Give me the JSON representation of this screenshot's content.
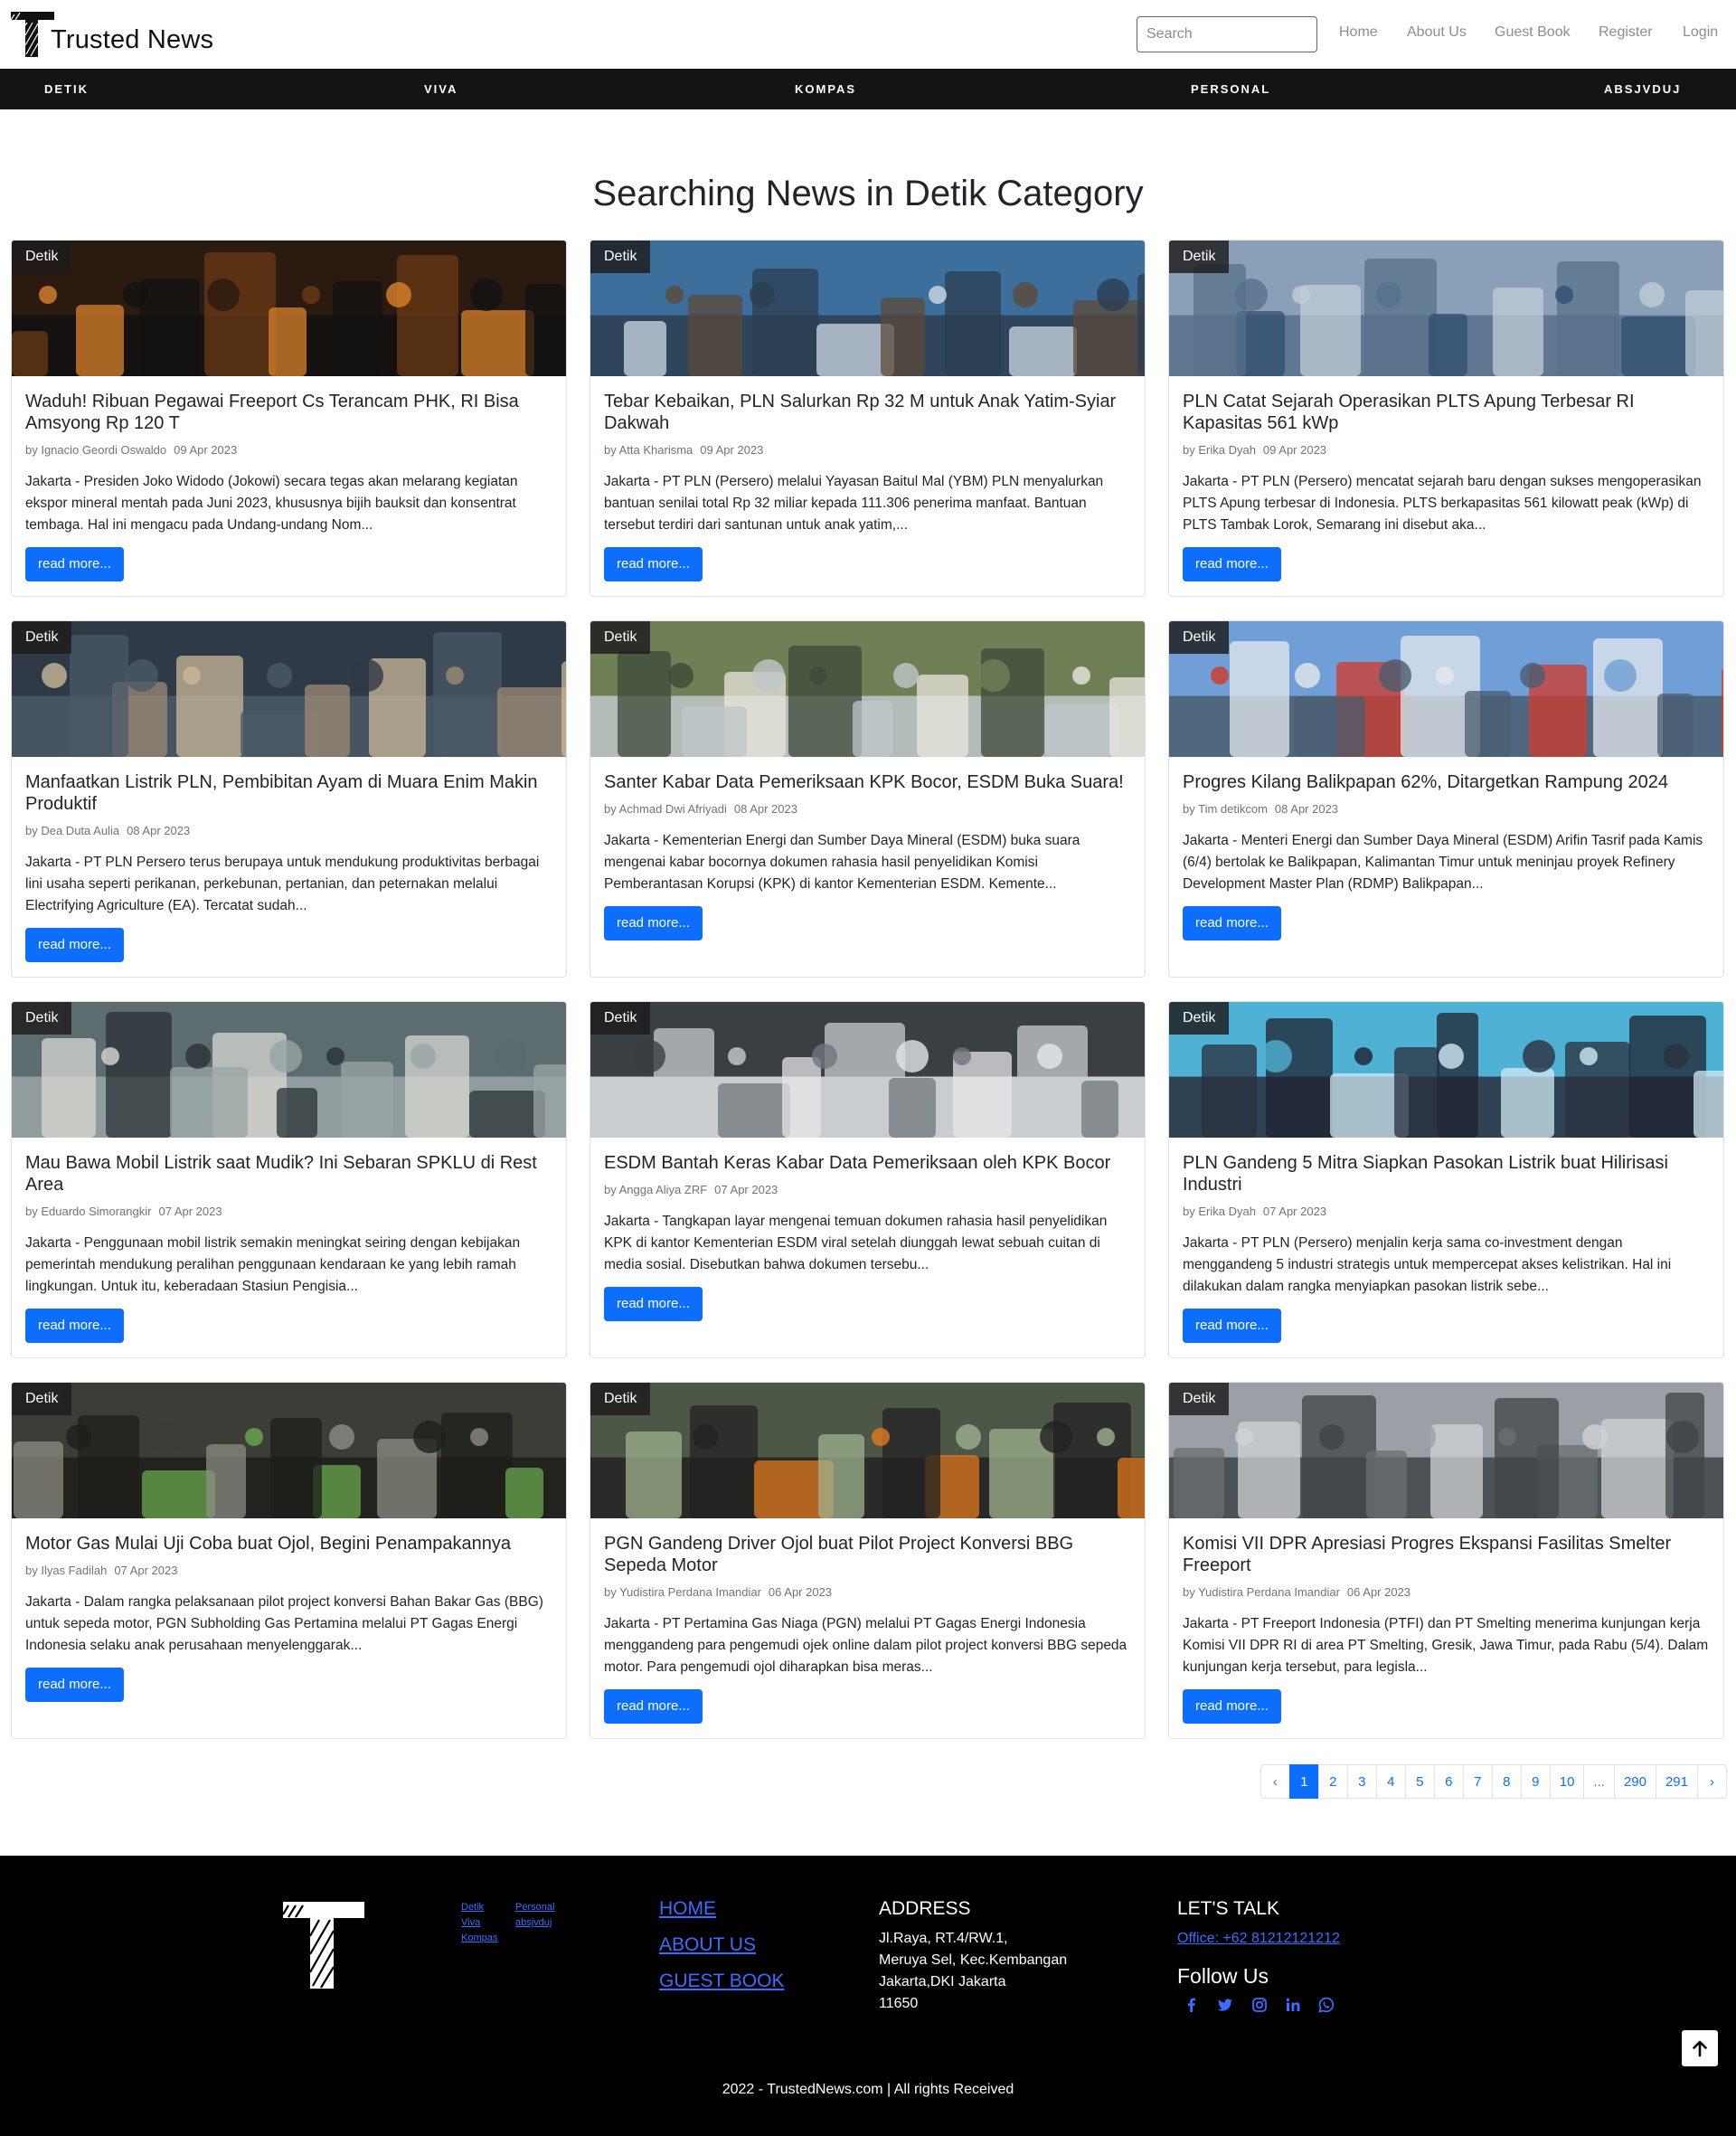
{
  "site": {
    "name": "Trusted News"
  },
  "search": {
    "placeholder": "Search"
  },
  "top_nav": [
    "Home",
    "About Us",
    "Guest Book",
    "Register",
    "Login"
  ],
  "categories": [
    "DETIK",
    "VIVA",
    "KOMPAS",
    "PERSONAL",
    "ABSJVDUJ"
  ],
  "page_title": "Searching News in Detik Category",
  "read_more_label": "read more...",
  "articles": [
    {
      "badge": "Detik",
      "title": "Waduh! Ribuan Pegawai Freeport Cs Terancam PHK, RI Bisa Amsyong Rp 120 T",
      "author": "by Ignacio Geordi Oswaldo",
      "date": "09 Apr 2023",
      "excerpt": "Jakarta - Presiden Joko Widodo (Jokowi) secara tegas akan melarang kegiatan ekspor mineral mentah pada Juni 2023, khususnya bijih bauksit dan konsentrat tembaga. Hal ini mengacu pada Undang-undang Nom..."
    },
    {
      "badge": "Detik",
      "title": "Tebar Kebaikan, PLN Salurkan Rp 32 M untuk Anak Yatim-Syiar Dakwah",
      "author": "by Atta Kharisma",
      "date": "09 Apr 2023",
      "excerpt": "Jakarta - PT PLN (Persero) melalui Yayasan Baitul Mal (YBM) PLN menyalurkan bantuan senilai total Rp 32 miliar kepada 111.306 penerima manfaat. Bantuan tersebut terdiri dari santunan untuk anak yatim,..."
    },
    {
      "badge": "Detik",
      "title": "PLN Catat Sejarah Operasikan PLTS Apung Terbesar RI Kapasitas 561 kWp",
      "author": "by Erika Dyah",
      "date": "09 Apr 2023",
      "excerpt": "Jakarta - PT PLN (Persero) mencatat sejarah baru dengan sukses mengoperasikan PLTS Apung terbesar di Indonesia. PLTS berkapasitas 561 kilowatt peak (kWp) di PLTS Tambak Lorok, Semarang ini disebut aka..."
    },
    {
      "badge": "Detik",
      "title": "Manfaatkan Listrik PLN, Pembibitan Ayam di Muara Enim Makin Produktif",
      "author": "by Dea Duta Aulia",
      "date": "08 Apr 2023",
      "excerpt": "Jakarta - PT PLN Persero terus berupaya untuk mendukung produktivitas berbagai lini usaha seperti perikanan, perkebunan, pertanian, dan peternakan melalui Electrifying Agriculture (EA). Tercatat sudah..."
    },
    {
      "badge": "Detik",
      "title": "Santer Kabar Data Pemeriksaan KPK Bocor, ESDM Buka Suara!",
      "author": "by Achmad Dwi Afriyadi",
      "date": "08 Apr 2023",
      "excerpt": "Jakarta - Kementerian Energi dan Sumber Daya Mineral (ESDM) buka suara mengenai kabar bocornya dokumen rahasia hasil penyelidikan Komisi Pemberantasan Korupsi (KPK) di kantor Kementerian ESDM. Kemente..."
    },
    {
      "badge": "Detik",
      "title": "Progres Kilang Balikpapan 62%, Ditargetkan Rampung 2024",
      "author": "by Tim detikcom",
      "date": "08 Apr 2023",
      "excerpt": "Jakarta - Menteri Energi dan Sumber Daya Mineral (ESDM) Arifin Tasrif pada Kamis (6/4) bertolak ke Balikpapan, Kalimantan Timur untuk meninjau proyek Refinery Development Master Plan (RDMP) Balikpapan..."
    },
    {
      "badge": "Detik",
      "title": "Mau Bawa Mobil Listrik saat Mudik? Ini Sebaran SPKLU di Rest Area",
      "author": "by Eduardo Simorangkir",
      "date": "07 Apr 2023",
      "excerpt": "Jakarta - Penggunaan mobil listrik semakin meningkat seiring dengan kebijakan pemerintah mendukung peralihan penggunaan kendaraan ke yang lebih ramah lingkungan. Untuk itu, keberadaan Stasiun Pengisia..."
    },
    {
      "badge": "Detik",
      "title": "ESDM Bantah Keras Kabar Data Pemeriksaan oleh KPK Bocor",
      "author": "by Angga Aliya ZRF",
      "date": "07 Apr 2023",
      "excerpt": "Jakarta - Tangkapan layar mengenai temuan dokumen rahasia hasil penyelidikan KPK di kantor Kementerian ESDM viral setelah diunggah lewat sebuah cuitan di media sosial. Disebutkan bahwa dokumen tersebu..."
    },
    {
      "badge": "Detik",
      "title": "PLN Gandeng 5 Mitra Siapkan Pasokan Listrik buat Hilirisasi Industri",
      "author": "by Erika Dyah",
      "date": "07 Apr 2023",
      "excerpt": "Jakarta - PT PLN (Persero) menjalin kerja sama co-investment dengan menggandeng 5 industri strategis untuk mempercepat akses kelistrikan. Hal ini dilakukan dalam rangka menyiapkan pasokan listrik sebe..."
    },
    {
      "badge": "Detik",
      "title": "Motor Gas Mulai Uji Coba buat Ojol, Begini Penampakannya",
      "author": "by Ilyas Fadilah",
      "date": "07 Apr 2023",
      "excerpt": "Jakarta - Dalam rangka pelaksanaan pilot project konversi Bahan Bakar Gas (BBG) untuk sepeda motor, PGN Subholding Gas Pertamina melalui PT Gagas Energi Indonesia selaku anak perusahaan menyelenggarak..."
    },
    {
      "badge": "Detik",
      "title": "PGN Gandeng Driver Ojol buat Pilot Project Konversi BBG Sepeda Motor",
      "author": "by Yudistira Perdana Imandiar",
      "date": "06 Apr 2023",
      "excerpt": "Jakarta - PT Pertamina Gas Niaga (PGN) melalui PT Gagas Energi Indonesia menggandeng para pengemudi ojek online dalam pilot project konversi BBG sepeda motor. Para pengemudi ojol diharapkan bisa meras..."
    },
    {
      "badge": "Detik",
      "title": "Komisi VII DPR Apresiasi Progres Ekspansi Fasilitas Smelter Freeport",
      "author": "by Yudistira Perdana Imandiar",
      "date": "06 Apr 2023",
      "excerpt": "Jakarta - PT Freeport Indonesia (PTFI) dan PT Smelting menerima kunjungan kerja Komisi VII DPR RI di area PT Smelting, Gresik, Jawa Timur, pada Rabu (5/4). Dalam kunjungan kerja tersebut, para legisla..."
    }
  ],
  "pagination": [
    "‹",
    "1",
    "2",
    "3",
    "4",
    "5",
    "6",
    "7",
    "8",
    "9",
    "10",
    "...",
    "290",
    "291",
    "›"
  ],
  "pagination_active": "1",
  "footer": {
    "categories": [
      "Detik",
      "Viva",
      "Kompas",
      "Personal",
      "absjvduj"
    ],
    "links": [
      "HOME",
      "ABOUT US",
      "GUEST BOOK"
    ],
    "address_heading": "ADDRESS",
    "address_lines": [
      "Jl.Raya, RT.4/RW.1,",
      "Meruya Sel, Kec.Kembangan",
      "Jakarta,DKI Jakarta",
      "11650"
    ],
    "talk_heading": "LET'S TALK",
    "phone": "Office: +62 81212121212",
    "follow_heading": "Follow Us",
    "social_icons": [
      "facebook-icon",
      "twitter-icon",
      "instagram-icon",
      "linkedin-icon",
      "whatsapp-icon"
    ],
    "copyright": "2022 - TrustedNews.com | All rights Received"
  },
  "colors": {
    "primary": "#0d6efd",
    "dark_bar": "#141416",
    "footer_bg": "#000000",
    "footer_link": "#3c6cff"
  }
}
